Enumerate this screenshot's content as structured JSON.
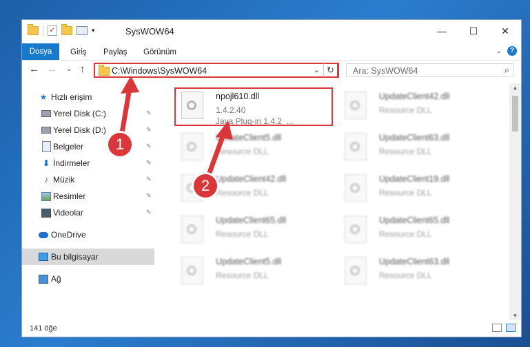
{
  "window": {
    "title": "SysWOW64",
    "caption": {
      "minimize": "—",
      "maximize": "☐",
      "close": "✕"
    }
  },
  "ribbon": {
    "tabs": [
      "Dosya",
      "Giriş",
      "Paylaş",
      "Görünüm"
    ],
    "collapse_glyph": "⌄",
    "help_glyph": "?"
  },
  "navigation": {
    "back": "←",
    "forward": "→",
    "recent": "⌄",
    "up": "↑",
    "address": "C:\\Windows\\SysWOW64",
    "address_dropdown": "⌄",
    "refresh": "↻",
    "search_placeholder": "Ara: SysWOW64",
    "search_icon": "⌕"
  },
  "sidebar": {
    "items": [
      {
        "label": "Hızlı erişim",
        "icon": "star-icon"
      },
      {
        "label": "Yerel Disk (C:)",
        "icon": "disk-icon",
        "pinned": true
      },
      {
        "label": "Yerel Disk (D:)",
        "icon": "disk-icon",
        "pinned": true
      },
      {
        "label": "Belgeler",
        "icon": "document-icon",
        "pinned": true
      },
      {
        "label": "İndirmeler",
        "icon": "download-icon",
        "pinned": true
      },
      {
        "label": "Müzik",
        "icon": "music-icon",
        "pinned": true
      },
      {
        "label": "Resimler",
        "icon": "pictures-icon",
        "pinned": true
      },
      {
        "label": "Videolar",
        "icon": "video-icon",
        "pinned": true
      },
      {
        "label": "OneDrive",
        "icon": "cloud-icon"
      },
      {
        "label": "Bu bilgisayar",
        "icon": "computer-icon",
        "selected": true
      },
      {
        "label": "Ağ",
        "icon": "network-icon"
      }
    ],
    "pin_glyph": "📌"
  },
  "files": {
    "highlighted": {
      "name": "npojl610.dll",
      "version": "1.4.2.40",
      "description": "Java Plug-in 1.4.2_..."
    },
    "left_column": [
      {
        "name": "UpdateClient5.dll",
        "type": "Resource DLL"
      },
      {
        "name": "UpdateClient42.dll",
        "type": "Resource DLL"
      },
      {
        "name": "UpdateClient65.dll",
        "type": "Resource DLL"
      },
      {
        "name": "UpdateClient5.dll",
        "type": "Resource DLL"
      }
    ],
    "right_column": [
      {
        "name": "UpdateClient42.dll",
        "type": "Resource DLL"
      },
      {
        "name": "UpdateClient63.dll",
        "type": "Resource DLL"
      },
      {
        "name": "UpdateClient19.dll",
        "type": "Resource DLL"
      },
      {
        "name": "UpdateClient65.dll",
        "type": "Resource DLL"
      },
      {
        "name": "UpdateClient63.dll",
        "type": "Resource DLL"
      }
    ]
  },
  "status": {
    "item_count": "141 öğe"
  },
  "callouts": {
    "one": "1",
    "two": "2"
  },
  "colors": {
    "accent": "#1979ca",
    "highlight": "#d9383a",
    "desktop": "#2b7dcf"
  }
}
